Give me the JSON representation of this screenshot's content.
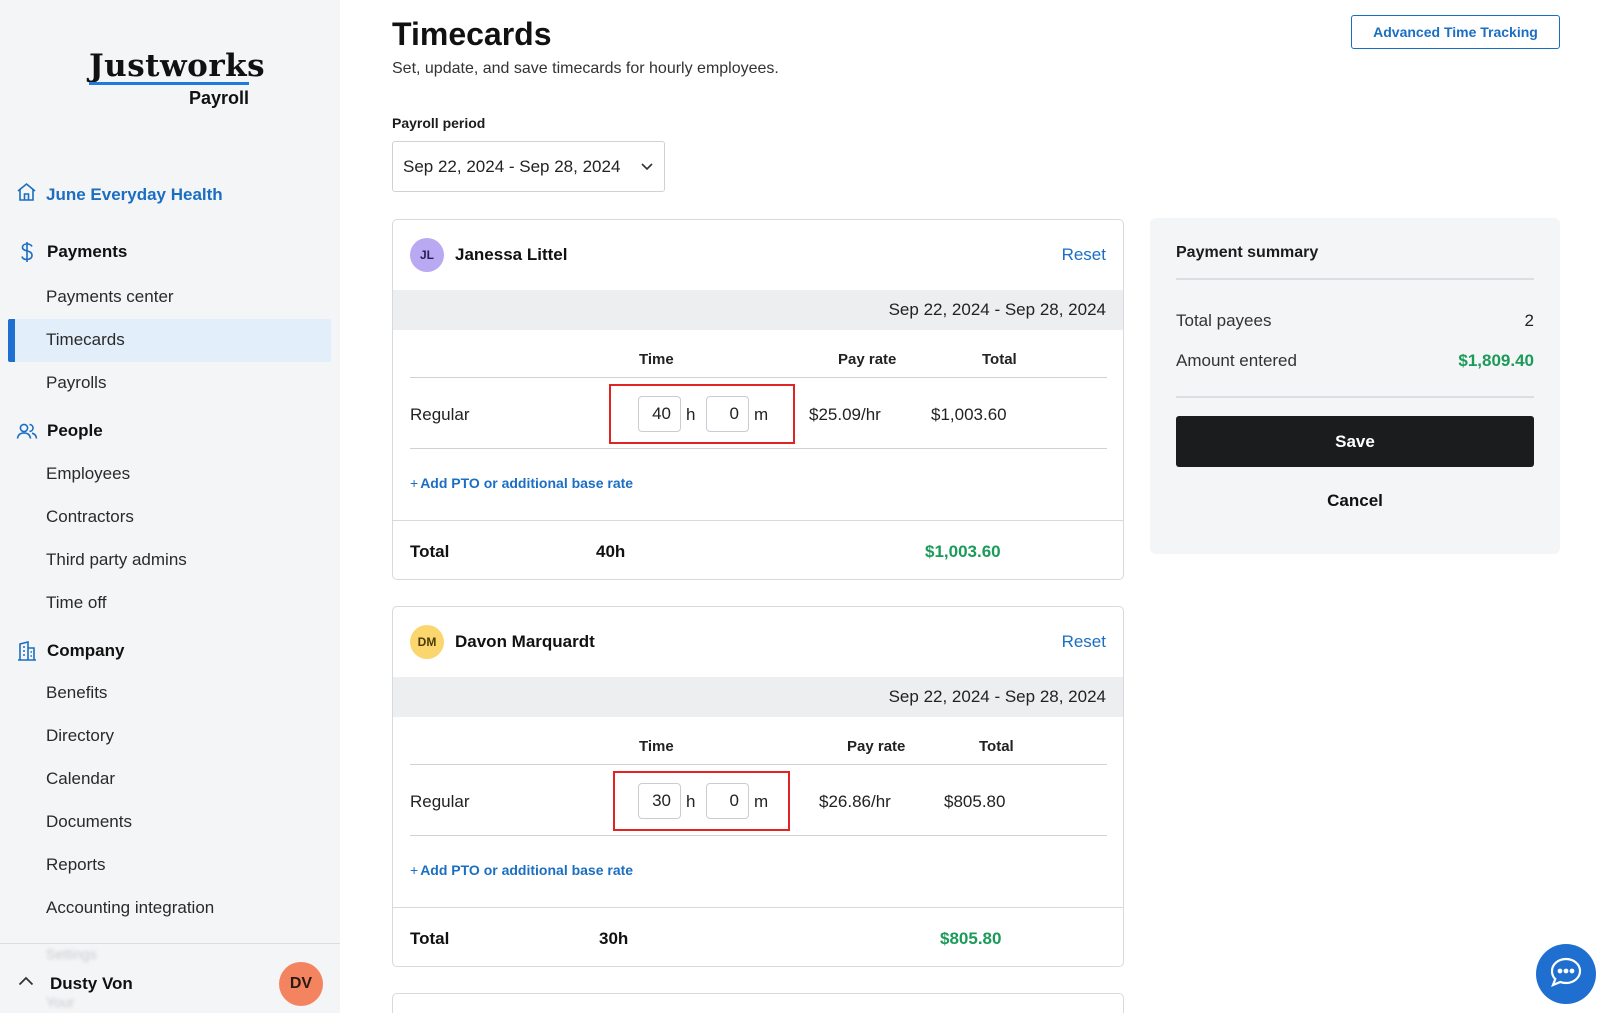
{
  "app": {
    "brand": "Justworks",
    "product": "Payroll"
  },
  "sidebar": {
    "company": {
      "label": "June Everyday Health",
      "icon": "home-icon"
    },
    "sections": [
      {
        "label": "Payments",
        "icon": "dollar-icon",
        "items": [
          "Payments center",
          "Timecards",
          "Payrolls"
        ]
      },
      {
        "label": "People",
        "icon": "people-icon",
        "items": [
          "Employees",
          "Contractors",
          "Third party admins",
          "Time off"
        ]
      },
      {
        "label": "Company",
        "icon": "building-icon",
        "items": [
          "Benefits",
          "Directory",
          "Calendar",
          "Documents",
          "Reports",
          "Accounting integration"
        ]
      }
    ],
    "active_item": "Timecards",
    "footer_ghost": [
      "Settings",
      "Your"
    ],
    "user": {
      "name": "Dusty Von",
      "initials": "DV"
    }
  },
  "header": {
    "title": "Timecards",
    "subtitle": "Set, update, and save timecards for hourly employees.",
    "advanced_button": "Advanced Time Tracking"
  },
  "period": {
    "label": "Payroll period",
    "value": "Sep 22, 2024 - Sep 28, 2024"
  },
  "columns": {
    "time": "Time",
    "rate": "Pay rate",
    "total": "Total"
  },
  "units": {
    "hours": "h",
    "minutes": "m"
  },
  "labels": {
    "reset": "Reset",
    "add_pto": "Add PTO or additional base rate",
    "add_plus": "+",
    "total": "Total"
  },
  "employees": [
    {
      "name": "Janessa Littel",
      "initials": "JL",
      "avatar_color": "#b9a8f2",
      "period": "Sep 22, 2024 - Sep 28, 2024",
      "row_label": "Regular",
      "hours": "40",
      "minutes": "0",
      "rate": "$25.09/hr",
      "row_total": "$1,003.60",
      "total_hours": "40h",
      "total_amount": "$1,003.60"
    },
    {
      "name": "Davon Marquardt",
      "initials": "DM",
      "avatar_color": "#fbd66e",
      "period": "Sep 22, 2024 - Sep 28, 2024",
      "row_label": "Regular",
      "hours": "30",
      "minutes": "0",
      "rate": "$26.86/hr",
      "row_total": "$805.80",
      "total_hours": "30h",
      "total_amount": "$805.80"
    }
  ],
  "summary": {
    "title": "Payment summary",
    "payees_label": "Total payees",
    "payees_value": "2",
    "amount_label": "Amount entered",
    "amount_value": "$1,809.40",
    "save_label": "Save",
    "cancel_label": "Cancel"
  },
  "colors": {
    "accent": "#1b6ec2",
    "positive": "#1b9a5a",
    "highlight_box": "#e02424"
  }
}
